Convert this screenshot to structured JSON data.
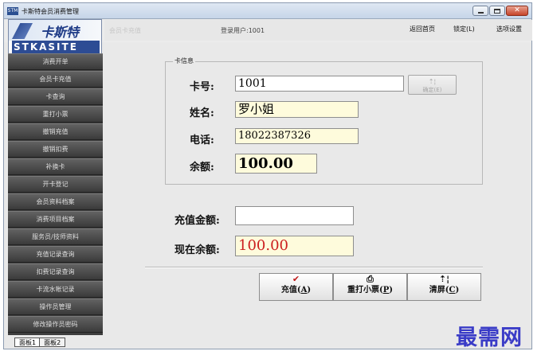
{
  "window": {
    "title": "卡斯特会员消费管理",
    "icon_text": "STM"
  },
  "logo": {
    "cn": "卡斯特",
    "en": "STKASITE"
  },
  "header": {
    "breadcrumb": "会员卡充值",
    "login_user": "登录用户:1001",
    "links": {
      "home": "返回首页",
      "lock": "锁定(L)",
      "settings": "选项设置"
    }
  },
  "sidebar": {
    "items": [
      "消费开单",
      "会员卡充值",
      "卡查询",
      "重打小票",
      "撤销充值",
      "撤销扣费",
      "补换卡",
      "开卡登记",
      "会员资料档案",
      "消费项目档案",
      "服务员/技师资料",
      "充值记录查询",
      "扣费记录查询",
      "卡流水帐记录",
      "操作员管理",
      "修改操作员密码"
    ],
    "tabs": [
      "面板1",
      "面板2"
    ]
  },
  "card_info": {
    "legend": "卡信息",
    "card_no_label": "卡号:",
    "card_no_value": "1001",
    "confirm_label": "确定(E)",
    "name_label": "姓名:",
    "name_value": "罗小姐",
    "phone_label": "电话:",
    "phone_value": "18022387326",
    "balance_label": "余额:",
    "balance_value": "100.00"
  },
  "recharge": {
    "amount_label": "充值金额:",
    "amount_value": "",
    "current_label": "现在余额:",
    "current_value": "100.00"
  },
  "actions": {
    "recharge": {
      "pre": "充值(",
      "key": "A",
      "post": ")",
      "icon": "check-icon"
    },
    "reprint": {
      "pre": "重打小票(",
      "key": "P",
      "post": ")",
      "icon": "printer-icon"
    },
    "clear": {
      "pre": "清屏(",
      "key": "C",
      "post": ")",
      "icon": "clear-icon"
    }
  },
  "watermark": "最需网",
  "colors": {
    "current_balance": "#cc1f1f",
    "sidebar": "#3e3e3e",
    "watermark": "#3a3cc7",
    "yellow_field": "#fefbdc"
  }
}
